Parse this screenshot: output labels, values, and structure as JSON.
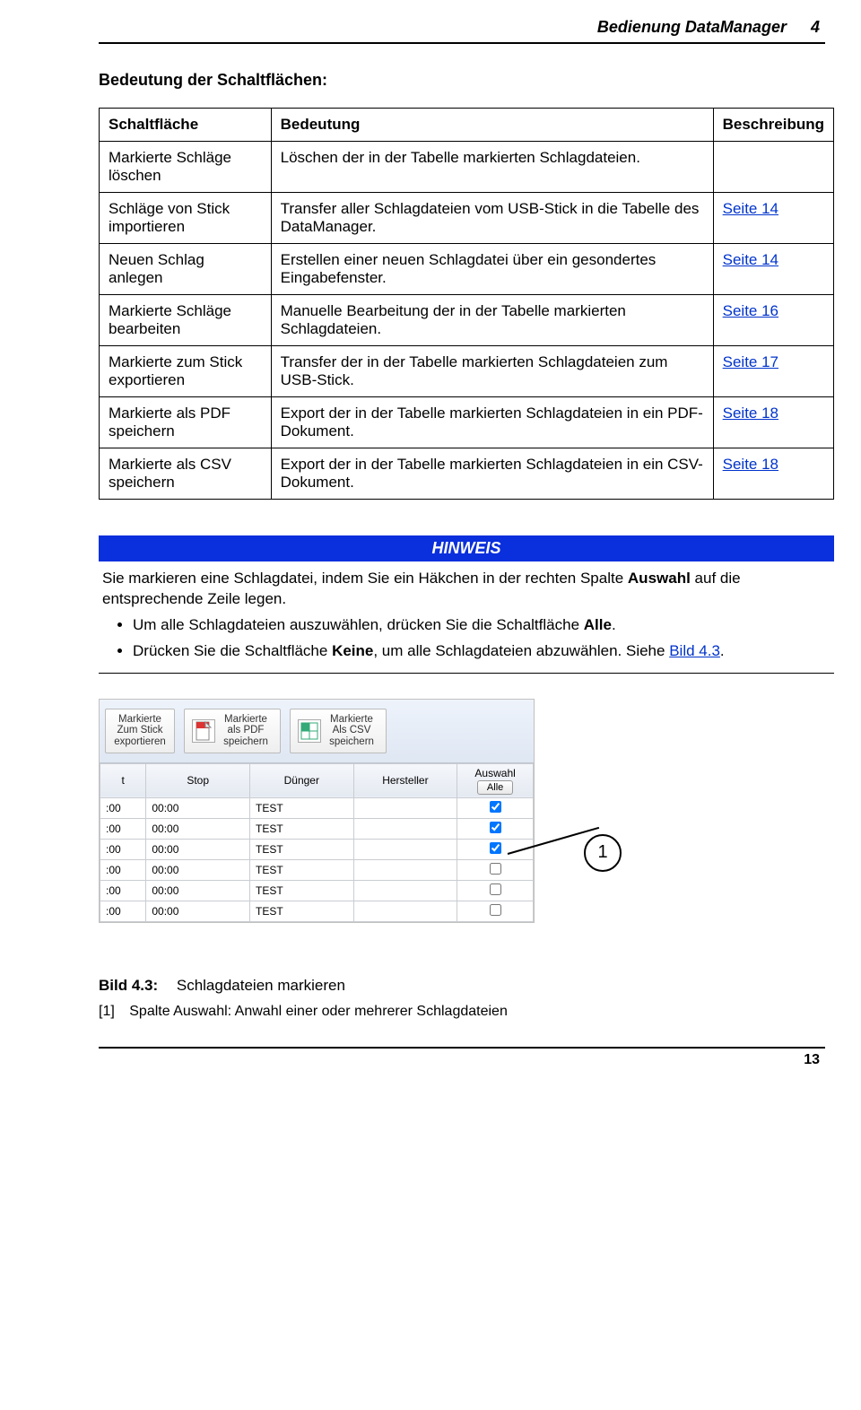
{
  "header": {
    "title": "Bedienung DataManager",
    "chapter": "4"
  },
  "section_heading": "Bedeutung der Schaltflächen:",
  "table": {
    "headers": {
      "c1": "Schaltfläche",
      "c2": "Bedeutung",
      "c3": "Beschreibung"
    },
    "rows": [
      {
        "name": "Markierte Schläge löschen",
        "meaning": "Löschen der in der Tabelle markierten Schlagdateien.",
        "desc": ""
      },
      {
        "name": "Schläge von Stick importieren",
        "meaning": "Transfer aller Schlagdateien vom USB-Stick in die Tabelle des DataManager.",
        "desc": "Seite 14"
      },
      {
        "name": "Neuen Schlag anlegen",
        "meaning": "Erstellen einer neuen Schlagdatei über ein gesondertes Eingabefenster.",
        "desc": "Seite 14"
      },
      {
        "name": "Markierte Schläge bearbeiten",
        "meaning": "Manuelle Bearbeitung der in der Tabelle markierten Schlagdateien.",
        "desc": "Seite 16"
      },
      {
        "name": "Markierte zum Stick exportieren",
        "meaning": "Transfer der in der Tabelle markierten Schlagdateien zum USB-Stick.",
        "desc": "Seite 17"
      },
      {
        "name": "Markierte als PDF speichern",
        "meaning": "Export der in der Tabelle markierten Schlagdateien in ein PDF-Dokument.",
        "desc": "Seite 18"
      },
      {
        "name": "Markierte als CSV speichern",
        "meaning": "Export der in der Tabelle markierten Schlagdateien in ein CSV-Dokument.",
        "desc": "Seite 18"
      }
    ]
  },
  "note": {
    "title": "HINWEIS",
    "intro_pre": "Sie markieren eine Schlagdatei, indem Sie ein Häkchen in der rechten Spalte ",
    "intro_bold": "Auswahl",
    "intro_post": " auf die entsprechende Zeile legen.",
    "bullets": [
      {
        "pre": "Um alle Schlagdateien auszuwählen, drücken Sie die Schaltfläche ",
        "bold": "Alle",
        "post": "."
      },
      {
        "pre": "Drücken Sie die Schaltfläche ",
        "bold": "Keine",
        "post": ", um alle Schlagdateien abzuwählen. Siehe ",
        "link": "Bild 4.3",
        "tail": "."
      }
    ]
  },
  "screenshot": {
    "toolbar_buttons": [
      {
        "id": "export-stick",
        "icon": "⤴",
        "label": "Markierte Zum Stick exportieren"
      },
      {
        "id": "save-pdf",
        "icon": "📄",
        "label": "Markierte als PDF speichern"
      },
      {
        "id": "save-csv",
        "icon": "📊",
        "label": "Markierte Als CSV speichern"
      }
    ],
    "grid_headers": {
      "t": "t",
      "stop": "Stop",
      "duenger": "Dünger",
      "hersteller": "Hersteller",
      "auswahl": "Auswahl",
      "alle_btn": "Alle"
    },
    "rows": [
      {
        "t": ":00",
        "stop": "00:00",
        "duenger": "TEST",
        "hersteller": "",
        "checked": true
      },
      {
        "t": ":00",
        "stop": "00:00",
        "duenger": "TEST",
        "hersteller": "",
        "checked": true
      },
      {
        "t": ":00",
        "stop": "00:00",
        "duenger": "TEST",
        "hersteller": "",
        "checked": true
      },
      {
        "t": ":00",
        "stop": "00:00",
        "duenger": "TEST",
        "hersteller": "",
        "checked": false
      },
      {
        "t": ":00",
        "stop": "00:00",
        "duenger": "TEST",
        "hersteller": "",
        "checked": false
      },
      {
        "t": ":00",
        "stop": "00:00",
        "duenger": "TEST",
        "hersteller": "",
        "checked": false
      }
    ]
  },
  "callout_number": "1",
  "caption": {
    "label": "Bild 4.3:",
    "text": "Schlagdateien markieren"
  },
  "legend": {
    "num": "[1]",
    "text": "Spalte Auswahl: Anwahl einer oder mehrerer Schlagdateien"
  },
  "footer_page": "13"
}
